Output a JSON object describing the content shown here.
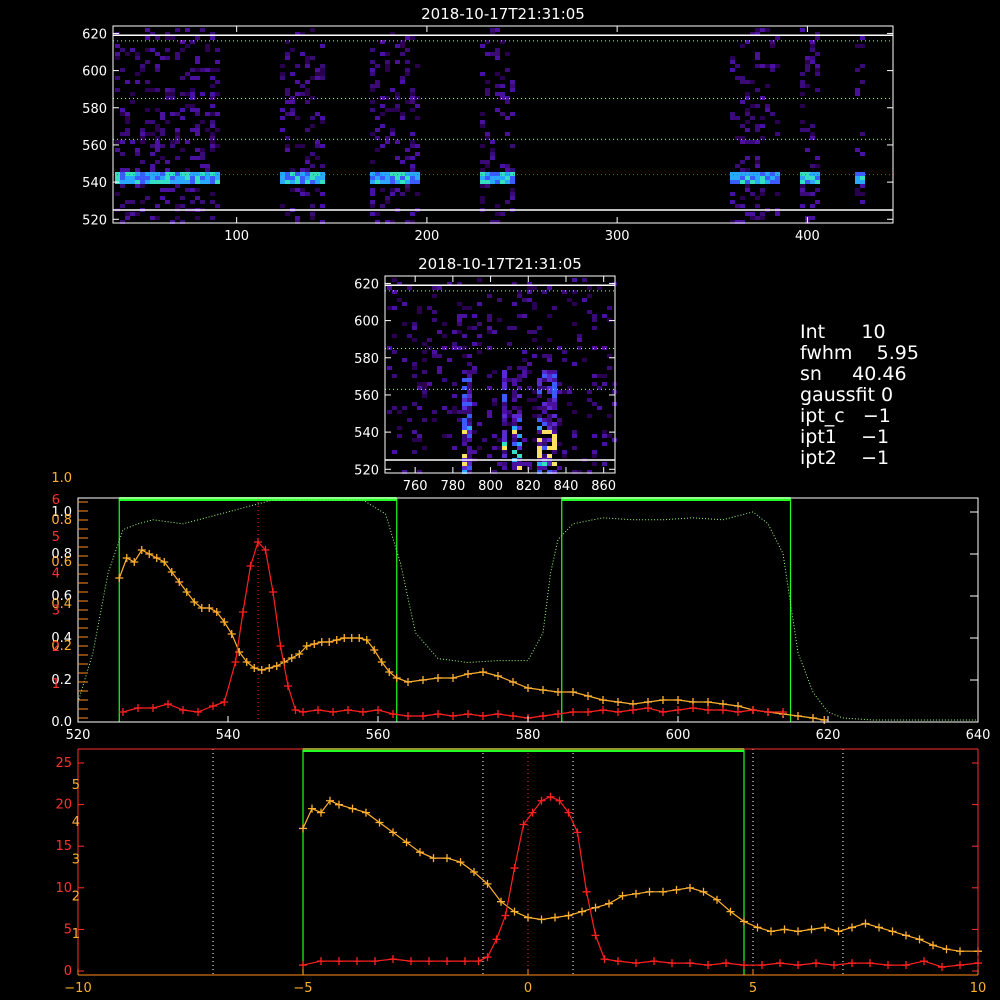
{
  "colors": {
    "background": "#000000",
    "axes": "#ffffff",
    "red_series": "#ff2020",
    "orange_series": "#ffb030",
    "green_box": "#22ff22",
    "green_dotted": "#9aff7a",
    "orange_axis": "#ff8c1a",
    "red_axis": "#ff3030"
  },
  "info_panel": {
    "int": {
      "label": "Int",
      "value": "10"
    },
    "fwhm": {
      "label": "fwhm",
      "value": "5.95"
    },
    "sn": {
      "label": "sn",
      "value": "40.46"
    },
    "gaussfit": {
      "label": "gaussfit",
      "value": "0"
    },
    "ipt_c": {
      "label": "ipt_c",
      "value": "−1"
    },
    "ipt1": {
      "label": "ipt1",
      "value": "−1"
    },
    "ipt2": {
      "label": "ipt2",
      "value": "−1"
    }
  },
  "chart_data": [
    {
      "id": "spectrogram-wide",
      "type": "heatmap",
      "title": "2018-10-17T21:31:05",
      "xlim": [
        35,
        445
      ],
      "ylim": [
        518,
        624
      ],
      "xticks": [
        "100",
        "200",
        "300",
        "400"
      ],
      "xtick_values": [
        100,
        200,
        300,
        400
      ],
      "yticks": [
        "520",
        "540",
        "560",
        "580",
        "600",
        "620"
      ],
      "ytick_values": [
        520,
        540,
        560,
        580,
        600,
        620
      ],
      "solid_hlines": [
        525,
        619
      ],
      "dotted_hlines": [
        {
          "y": 616,
          "color": "green"
        },
        {
          "y": 585,
          "color": "green"
        },
        {
          "y": 563,
          "color": "green"
        },
        {
          "y": 544,
          "color": "red"
        }
      ],
      "bright_band_y": 543,
      "signal_columns": [
        [
          35,
          90
        ],
        [
          121,
          146
        ],
        [
          170,
          196
        ],
        [
          226,
          244
        ],
        [
          358,
          384
        ],
        [
          395,
          404
        ],
        [
          425,
          429
        ]
      ]
    },
    {
      "id": "spectrogram-zoom",
      "type": "heatmap",
      "title": "2018-10-17T21:31:05",
      "xlim": [
        744,
        866
      ],
      "ylim": [
        518,
        624
      ],
      "xticks": [
        "760",
        "780",
        "800",
        "820",
        "840",
        "860"
      ],
      "xtick_values": [
        760,
        780,
        800,
        820,
        840,
        860
      ],
      "yticks": [
        "520",
        "540",
        "560",
        "580",
        "600",
        "620"
      ],
      "ytick_values": [
        520,
        540,
        560,
        580,
        600,
        620
      ],
      "solid_hlines": [
        525,
        619
      ],
      "dotted_hlines": [
        {
          "y": 616,
          "color": "green"
        },
        {
          "y": 585,
          "color": "green"
        },
        {
          "y": 563,
          "color": "green"
        }
      ],
      "streak_columns": [
        786,
        806,
        812,
        826,
        832
      ]
    },
    {
      "id": "profile-wavelength",
      "type": "line",
      "xlim": [
        520,
        640
      ],
      "xticks": [
        "520",
        "540",
        "560",
        "580",
        "600",
        "620",
        "640"
      ],
      "xtick_values": [
        520,
        540,
        560,
        580,
        600,
        620,
        640
      ],
      "left_orange_ticks": [
        "0.0",
        "0.2",
        "0.4",
        "0.6",
        "0.8",
        "1.0"
      ],
      "left_red_ticks": [
        "1",
        "2",
        "3",
        "4",
        "5",
        "6"
      ],
      "left_white_ticks": [
        "0.0",
        "0.2",
        "0.4",
        "0.6",
        "0.8",
        "1.0"
      ],
      "green_boxes": [
        [
          525.5,
          562.5
        ],
        [
          584.5,
          615
        ]
      ],
      "red_dotted_vline": 544,
      "transmission_curve": {
        "x": [
          520,
          522,
          524,
          526,
          528,
          530,
          534,
          538,
          542,
          546,
          550,
          554,
          558,
          561,
          563,
          565,
          568,
          572,
          576,
          580,
          582,
          583,
          584,
          586,
          590,
          594,
          598,
          602,
          606,
          610,
          612,
          614,
          615,
          616,
          618,
          620,
          622,
          626,
          632,
          640
        ],
        "y": [
          0.1,
          0.35,
          0.75,
          0.97,
          1.0,
          1.02,
          1.0,
          1.04,
          1.08,
          1.12,
          1.12,
          1.12,
          1.12,
          1.05,
          0.8,
          0.45,
          0.32,
          0.3,
          0.31,
          0.31,
          0.45,
          0.75,
          0.92,
          1.0,
          1.03,
          1.02,
          1.02,
          1.03,
          1.02,
          1.06,
          1.0,
          0.85,
          0.6,
          0.35,
          0.15,
          0.05,
          0.02,
          0.01,
          0.01,
          0.01
        ]
      },
      "series": [
        {
          "name": "",
          "color": "red",
          "x": [
            526,
            528,
            530,
            532,
            534,
            536,
            538,
            539.5,
            541,
            542,
            543,
            544,
            545,
            546,
            547,
            548,
            549,
            550,
            552,
            554,
            556,
            558,
            560,
            562,
            564,
            566,
            568,
            570,
            572,
            574,
            576,
            578,
            580,
            582,
            584,
            586,
            588,
            590,
            592,
            594,
            596,
            598,
            600,
            602,
            604,
            606,
            608,
            610,
            612,
            614
          ],
          "y": [
            0.05,
            0.07,
            0.07,
            0.09,
            0.06,
            0.05,
            0.08,
            0.1,
            0.3,
            0.55,
            0.78,
            0.9,
            0.86,
            0.65,
            0.38,
            0.18,
            0.06,
            0.05,
            0.06,
            0.05,
            0.06,
            0.05,
            0.06,
            0.04,
            0.03,
            0.03,
            0.04,
            0.03,
            0.04,
            0.03,
            0.04,
            0.03,
            0.02,
            0.03,
            0.04,
            0.05,
            0.05,
            0.06,
            0.05,
            0.06,
            0.07,
            0.05,
            0.06,
            0.07,
            0.06,
            0.06,
            0.05,
            0.06,
            0.05,
            0.05
          ]
        },
        {
          "name": "",
          "color": "orange",
          "x": [
            525.5,
            526.5,
            527.5,
            528.5,
            529.5,
            530.5,
            531.5,
            532.5,
            533.5,
            534.5,
            535.5,
            536.5,
            537.5,
            538.5,
            539.5,
            540.5,
            541.5,
            542.5,
            543.5,
            544.5,
            545.5,
            546.5,
            547.5,
            548.5,
            549.5,
            550.5,
            551.5,
            552.5,
            553.5,
            554.5,
            555.5,
            556.5,
            557.5,
            558.5,
            559.5,
            560.5,
            561.5,
            562.5,
            564,
            566,
            568,
            570,
            572,
            574,
            576,
            578,
            580,
            582,
            584,
            586,
            588,
            590,
            592,
            594,
            596,
            598,
            600,
            602,
            604,
            606,
            608,
            610,
            612,
            614,
            616,
            618,
            619.5
          ],
          "y": [
            0.72,
            0.82,
            0.8,
            0.86,
            0.84,
            0.82,
            0.8,
            0.75,
            0.7,
            0.65,
            0.6,
            0.57,
            0.57,
            0.55,
            0.5,
            0.44,
            0.35,
            0.3,
            0.27,
            0.26,
            0.27,
            0.28,
            0.3,
            0.32,
            0.34,
            0.38,
            0.39,
            0.4,
            0.4,
            0.41,
            0.42,
            0.42,
            0.42,
            0.41,
            0.36,
            0.3,
            0.25,
            0.22,
            0.2,
            0.21,
            0.22,
            0.22,
            0.24,
            0.25,
            0.23,
            0.2,
            0.17,
            0.16,
            0.15,
            0.15,
            0.13,
            0.11,
            0.1,
            0.09,
            0.1,
            0.11,
            0.11,
            0.1,
            0.1,
            0.09,
            0.08,
            0.06,
            0.05,
            0.04,
            0.03,
            0.02,
            0.01
          ]
        }
      ]
    },
    {
      "id": "profile-offset",
      "type": "line",
      "xlim": [
        -10,
        10
      ],
      "xticks": [
        "−10",
        "−5",
        "0",
        "5",
        "10"
      ],
      "xtick_values": [
        -10,
        -5,
        0,
        5,
        10
      ],
      "left_orange_ticks": [
        "0",
        "1",
        "2",
        "3",
        "4",
        "5"
      ],
      "left_red_ticks": [
        "0",
        "5",
        "10",
        "15",
        "20",
        "25"
      ],
      "green_box": [
        -5,
        4.8
      ],
      "white_dotted_vlines": [
        -7,
        -1,
        1,
        5,
        7
      ],
      "red_dotted_vline": 0,
      "series": [
        {
          "name": "",
          "color": "red",
          "x": [
            -5,
            -4.6,
            -4.2,
            -3.8,
            -3.4,
            -3.0,
            -2.6,
            -2.2,
            -1.8,
            -1.4,
            -1.1,
            -0.9,
            -0.7,
            -0.5,
            -0.3,
            -0.1,
            0.1,
            0.3,
            0.5,
            0.7,
            0.9,
            1.1,
            1.3,
            1.5,
            1.7,
            2.0,
            2.4,
            2.8,
            3.2,
            3.6,
            4.0,
            4.4,
            4.8,
            5.2,
            5.6,
            6.0,
            6.4,
            6.8,
            7.2,
            7.6,
            8.0,
            8.4,
            8.8,
            9.2,
            9.6,
            10
          ],
          "y": [
            0.03,
            0.05,
            0.05,
            0.05,
            0.05,
            0.06,
            0.05,
            0.05,
            0.05,
            0.05,
            0.05,
            0.07,
            0.16,
            0.28,
            0.52,
            0.74,
            0.8,
            0.86,
            0.88,
            0.86,
            0.8,
            0.7,
            0.4,
            0.18,
            0.06,
            0.05,
            0.04,
            0.05,
            0.04,
            0.04,
            0.03,
            0.04,
            0.03,
            0.03,
            0.04,
            0.03,
            0.04,
            0.03,
            0.04,
            0.04,
            0.03,
            0.03,
            0.05,
            0.02,
            0.03,
            0.04
          ]
        },
        {
          "name": "",
          "color": "orange",
          "x": [
            -5,
            -4.8,
            -4.6,
            -4.4,
            -4.2,
            -3.9,
            -3.6,
            -3.3,
            -3.0,
            -2.7,
            -2.4,
            -2.1,
            -1.8,
            -1.5,
            -1.2,
            -0.9,
            -0.6,
            -0.3,
            0.0,
            0.3,
            0.6,
            0.9,
            1.2,
            1.5,
            1.8,
            2.1,
            2.4,
            2.7,
            3.0,
            3.3,
            3.6,
            3.9,
            4.2,
            4.5,
            4.8,
            5.1,
            5.4,
            5.7,
            6.0,
            6.3,
            6.6,
            6.9,
            7.2,
            7.5,
            7.8,
            8.1,
            8.4,
            8.7,
            9.0,
            9.3,
            9.6,
            10
          ],
          "y": [
            0.72,
            0.82,
            0.8,
            0.86,
            0.84,
            0.82,
            0.8,
            0.75,
            0.7,
            0.65,
            0.6,
            0.57,
            0.57,
            0.55,
            0.5,
            0.44,
            0.35,
            0.3,
            0.27,
            0.26,
            0.27,
            0.28,
            0.3,
            0.32,
            0.34,
            0.38,
            0.39,
            0.4,
            0.4,
            0.41,
            0.42,
            0.4,
            0.36,
            0.3,
            0.25,
            0.22,
            0.2,
            0.21,
            0.2,
            0.21,
            0.22,
            0.2,
            0.22,
            0.24,
            0.22,
            0.2,
            0.18,
            0.16,
            0.13,
            0.11,
            0.1,
            0.1
          ]
        }
      ]
    }
  ]
}
